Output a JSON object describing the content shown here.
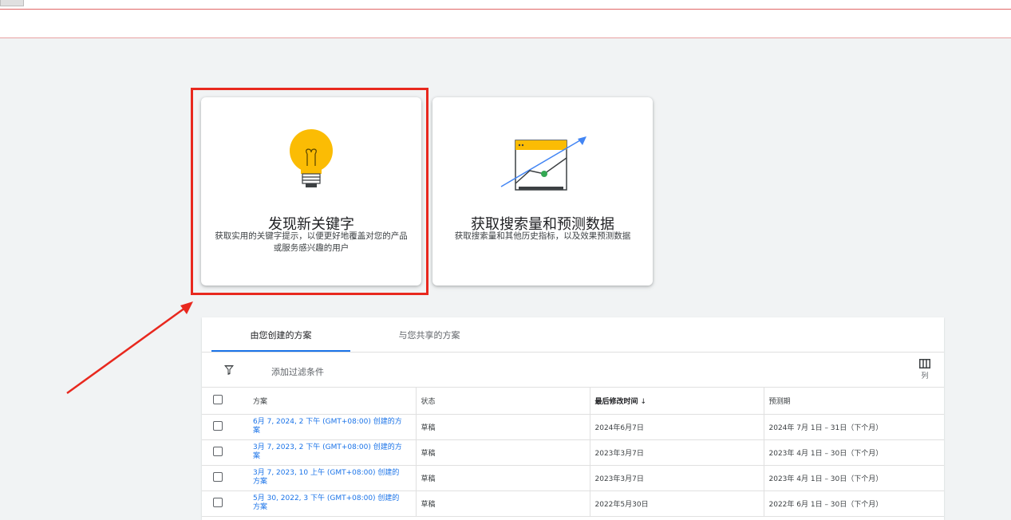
{
  "cards": [
    {
      "title": "发现新关键字",
      "desc": "获取实用的关键字提示，以便更好地覆盖对您的产品或服务感兴趣的用户",
      "icon": "lightbulb-icon"
    },
    {
      "title": "获取搜索量和预测数据",
      "desc": "获取搜索量和其他历史指标，以及效果预测数据",
      "icon": "forecast-chart-icon"
    }
  ],
  "tabs": [
    {
      "label": "由您创建的方案",
      "active": true
    },
    {
      "label": "与您共享的方案",
      "active": false
    }
  ],
  "filter": {
    "label": "添加过滤条件"
  },
  "columns_button": {
    "label": "列"
  },
  "table": {
    "headers": [
      "方案",
      "状态",
      "最后修改时间",
      "预测期"
    ],
    "sort_arrow": "↓",
    "rows": [
      {
        "plan": "6月 7, 2024, 2 下午 (GMT+08:00) 创建的方案",
        "status": "草稿",
        "modified": "2024年6月7日",
        "period": "2024年 7月 1日 – 31日（下个月）"
      },
      {
        "plan": "3月 7, 2023, 2 下午 (GMT+08:00) 创建的方案",
        "status": "草稿",
        "modified": "2023年3月7日",
        "period": "2023年 4月 1日 – 30日（下个月）"
      },
      {
        "plan": "3月 7, 2023, 10 上午 (GMT+08:00) 创建的方案",
        "status": "草稿",
        "modified": "2023年3月7日",
        "period": "2023年 4月 1日 – 30日（下个月）"
      },
      {
        "plan": "5月 30, 2022, 3 下午 (GMT+08:00) 创建的方案",
        "status": "草稿",
        "modified": "2022年5月30日",
        "period": "2022年 6月 1日 – 30日（下个月）"
      }
    ]
  },
  "colors": {
    "accent": "#1a73e8",
    "highlight": "#e8281e",
    "bulb": "#fbbc04",
    "point": "#34a853"
  }
}
